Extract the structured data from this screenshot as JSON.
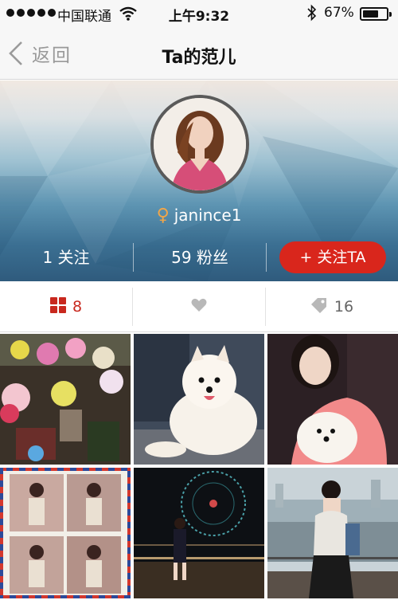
{
  "status_bar": {
    "carrier": "中国联通",
    "time": "上午9:32",
    "battery_percent": "67%",
    "battery_level": 0.67,
    "signal_icon": "signal-dots-icon",
    "wifi_icon": "wifi-icon",
    "bluetooth_icon": "bluetooth-icon"
  },
  "nav": {
    "back_label": "返回",
    "back_icon": "chevron-left-icon",
    "title": "Ta的范儿"
  },
  "profile": {
    "username": "janince1",
    "gender_icon": "female-icon",
    "gender_symbol": "♀",
    "following": "1 关注",
    "fans": "59 粉丝",
    "follow_button": "+ 关注TA"
  },
  "tabs": [
    {
      "icon": "grid-icon",
      "label": "8",
      "active": true
    },
    {
      "icon": "heart-icon",
      "label": "",
      "active": false
    },
    {
      "icon": "tag-icon",
      "label": "16",
      "active": false
    }
  ],
  "photos": [
    {
      "name": "photo-flower-shop"
    },
    {
      "name": "photo-white-dog"
    },
    {
      "name": "photo-woman-with-dog"
    },
    {
      "name": "photo-collage-woman"
    },
    {
      "name": "photo-ferris-wheel-night"
    },
    {
      "name": "photo-woman-harbor"
    }
  ],
  "colors": {
    "accent_red": "#d9261c",
    "active_tab": "#c8281e",
    "female_icon": "#f0a64a"
  }
}
